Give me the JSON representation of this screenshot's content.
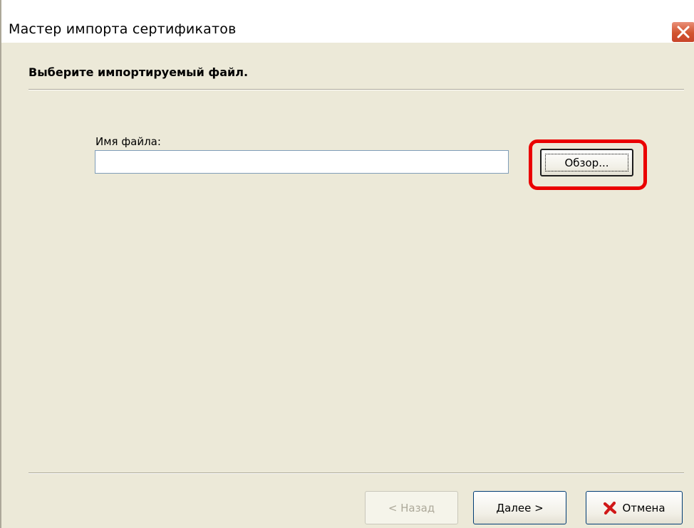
{
  "window": {
    "title": "Мастер импорта сертификатов"
  },
  "page": {
    "heading": "Выберите импортируемый файл."
  },
  "file": {
    "label": "Имя файла:",
    "value": "",
    "placeholder": ""
  },
  "buttons": {
    "browse_label": "Обзор...",
    "back_label": "< Назад",
    "next_label": "Далее >",
    "cancel_label": "Отмена"
  },
  "icons": {
    "close": "close-icon",
    "cancel": "red-x-icon"
  },
  "colors": {
    "dialog_bg": "#ece9d8",
    "highlight": "#ea0000",
    "close_button": "#d2542f",
    "cancel_icon": "#d01818"
  }
}
